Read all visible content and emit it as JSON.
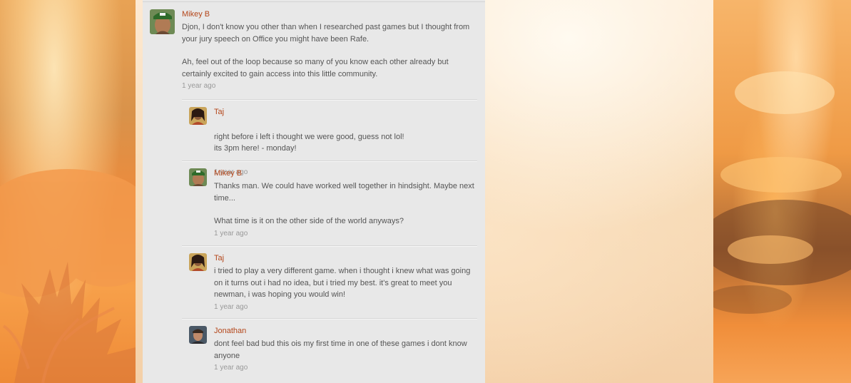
{
  "comments": [
    {
      "author": "Mikey B",
      "avatar_icon": "user-avatar-icon",
      "lines": [
        "Djon, I don't know you other than when I researched past games but I thought from your jury speech on Office you might have been Rafe.",
        "Ah, feel out of the loop because so many of you know each other already but certainly excited to gain access into this little community."
      ],
      "time": "1 year ago"
    }
  ],
  "replies": [
    {
      "author": "Taj",
      "avatar_icon": "user-avatar-icon",
      "lines": [
        "right before i left i thought we were good, guess not lol!\nits 3pm here! - monday!"
      ],
      "time": "1 year ago"
    },
    {
      "author": "Mikey B",
      "avatar_icon": "user-avatar-icon",
      "lines": [
        "Thanks man. We could have worked well together in hindsight. Maybe next time...",
        "What time is it on the other side of the world anyways?"
      ],
      "time": "1 year ago"
    },
    {
      "author": "Taj",
      "avatar_icon": "user-avatar-icon",
      "lines": [
        "i tried to play a very different game. when i thought i knew what was going on it turns out i had no idea, but i tried my best. it's great to meet you newman, i was hoping you would win!"
      ],
      "time": "1 year ago"
    },
    {
      "author": "Jonathan",
      "avatar_icon": "user-avatar-icon",
      "lines": [
        "dont feel bad bud this ois my first time in one of these games i dont know anyone"
      ],
      "time": "1 year ago"
    }
  ],
  "colors": {
    "author": "#b4461a",
    "text": "#555555",
    "timestamp": "#999999",
    "column_bg": "#e8e8e8"
  }
}
